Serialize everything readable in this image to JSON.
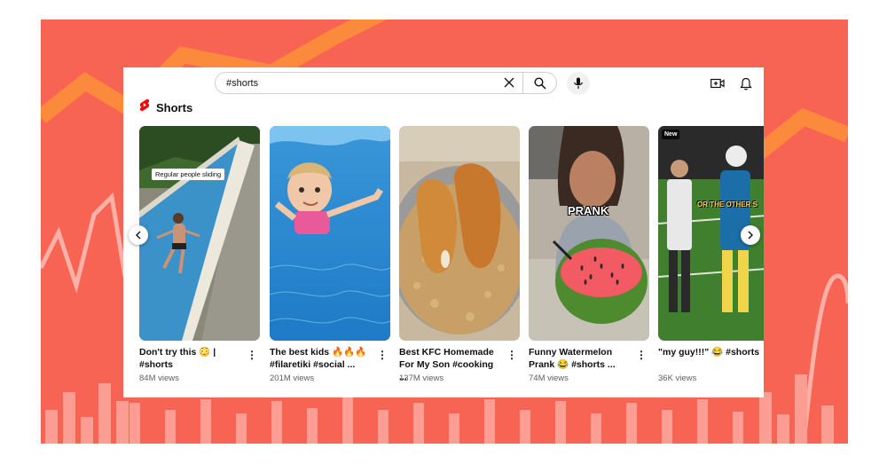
{
  "search": {
    "query": "#shorts"
  },
  "section": {
    "title": "Shorts"
  },
  "icons": {
    "clear": "close-icon",
    "search": "search-icon",
    "mic": "mic-icon",
    "create": "create-video-icon",
    "notifications": "bell-icon",
    "shorts_logo": "shorts-logo-icon",
    "prev": "chevron-left-icon",
    "next": "chevron-right-icon",
    "more": "more-vert-icon"
  },
  "colors": {
    "brand_red": "#ff0000",
    "background_coral": "#f86454",
    "title_text": "#0f0f0f",
    "meta_text": "#606060"
  },
  "shorts": [
    {
      "title": "Don't try this 😳 |\n#shorts",
      "views": "84M views",
      "overlay": "Regular people sliding"
    },
    {
      "title": "The best kids 🔥🔥🔥\n#filaretiki #social ...",
      "views": "201M views"
    },
    {
      "title": "Best KFC Homemade\nFor My Son #cooking ...",
      "views": "137M views"
    },
    {
      "title": "Funny Watermelon\nPrank 😂 #shorts ...",
      "views": "74M views",
      "overlay": "PRANK"
    },
    {
      "title": "\"my guy!!!\" 😂 #shorts",
      "views": "36K views",
      "badge": "New",
      "overlay": "OR THE OTHER S"
    }
  ]
}
